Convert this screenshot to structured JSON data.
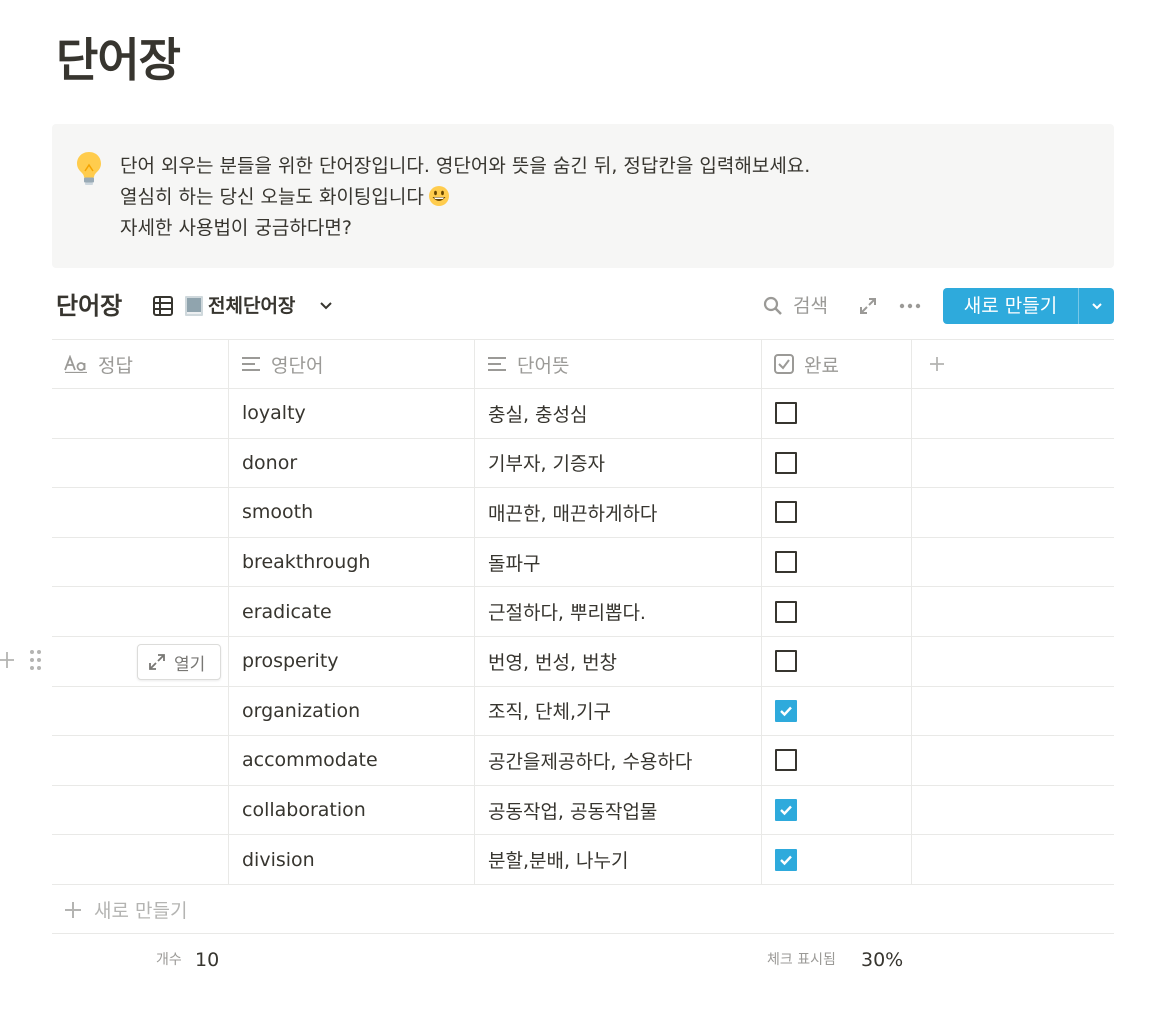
{
  "page": {
    "title": "단어장"
  },
  "callout": {
    "icon": "lightbulb-icon",
    "lines": [
      "단어 외우는 분들을 위한 단어장입니다. 영단어와 뜻을 숨긴 뒤, 정답칸을 입력해보세요.",
      "열심히 하는 당신 오늘도 화이팅입니다",
      "자세한 사용법이 궁금하다면?"
    ],
    "emoji": "grinning-face-emoji"
  },
  "database": {
    "title": "단어장",
    "view_name": "전체단어장",
    "search_label": "검색",
    "new_button_label": "새로 만들기"
  },
  "columns": [
    {
      "label": "정답",
      "icon": "text-type-icon"
    },
    {
      "label": "영단어",
      "icon": "lines-icon"
    },
    {
      "label": "단어뜻",
      "icon": "lines-icon"
    },
    {
      "label": "완료",
      "icon": "checkbox-icon"
    }
  ],
  "rows": [
    {
      "answer": "",
      "word": "loyalty",
      "meaning": "충실, 충성심",
      "done": false
    },
    {
      "answer": "",
      "word": "donor",
      "meaning": "기부자, 기증자",
      "done": false
    },
    {
      "answer": "",
      "word": "smooth",
      "meaning": "매끈한, 매끈하게하다",
      "done": false
    },
    {
      "answer": "",
      "word": "breakthrough",
      "meaning": "돌파구",
      "done": false
    },
    {
      "answer": "",
      "word": "eradicate",
      "meaning": "근절하다, 뿌리뽑다.",
      "done": false
    },
    {
      "answer": "",
      "word": "prosperity",
      "meaning": "번영, 번성, 번창",
      "done": false
    },
    {
      "answer": "",
      "word": "organization",
      "meaning": "조직, 단체,기구",
      "done": true
    },
    {
      "answer": "",
      "word": "accommodate",
      "meaning": "공간을제공하다, 수용하다",
      "done": false
    },
    {
      "answer": "",
      "word": "collaboration",
      "meaning": "공동작업, 공동작업물",
      "done": true
    },
    {
      "answer": "",
      "word": "division",
      "meaning": "분할,분배, 나누기",
      "done": true
    }
  ],
  "hover_row": {
    "open_label": "열기"
  },
  "add_row_label": "새로 만들기",
  "footer": {
    "count_label": "개수",
    "count_value": "10",
    "checked_label": "체크 표시됨",
    "checked_value": "30%"
  },
  "colors": {
    "accent": "#2eaadc",
    "text": "#37352f",
    "muted": "#9b9a97",
    "border": "#e9e9e7",
    "callout_bg": "#f6f6f5"
  }
}
